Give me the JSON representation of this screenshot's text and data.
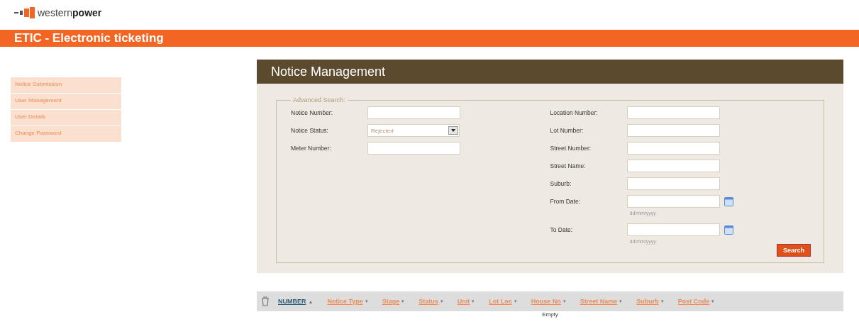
{
  "logo": {
    "text_light": "western",
    "text_bold": "power"
  },
  "banner": {
    "title": "ETIC - Electronic ticketing"
  },
  "sidebar": {
    "items": [
      {
        "label": "Notice Submission"
      },
      {
        "label": "User Management"
      },
      {
        "label": "User Details"
      },
      {
        "label": "Change Password"
      }
    ]
  },
  "panel": {
    "title": "Notice Management"
  },
  "search": {
    "legend": "Advanced Search:",
    "left_fields": [
      {
        "kind": "text",
        "label": "Notice Number:"
      },
      {
        "kind": "select",
        "label": "Notice Status:",
        "value": "Rejected"
      },
      {
        "kind": "text",
        "label": "Meter Number:"
      }
    ],
    "right_fields": [
      {
        "kind": "text",
        "label": "Location Number:"
      },
      {
        "kind": "text",
        "label": "Lot Number:"
      },
      {
        "kind": "text",
        "label": "Street Number:"
      },
      {
        "kind": "text",
        "label": "Street Name:"
      },
      {
        "kind": "text",
        "label": "Suburb:"
      },
      {
        "kind": "date",
        "label": "From Date:",
        "hint": "dd/mm/yyyy"
      },
      {
        "kind": "date",
        "label": "To Date:",
        "hint": "dd/mm/yyyy"
      }
    ],
    "button": "Search"
  },
  "table": {
    "columns": [
      {
        "label": "NUMBER",
        "arrow": "▲",
        "selected": true
      },
      {
        "label": "Notice Type",
        "arrow": "▾",
        "selected": false
      },
      {
        "label": "Stage",
        "arrow": "▾",
        "selected": false
      },
      {
        "label": "Status",
        "arrow": "▾",
        "selected": false
      },
      {
        "label": "Unit",
        "arrow": "▾",
        "selected": false
      },
      {
        "label": "Lot Loc",
        "arrow": "▾",
        "selected": false
      },
      {
        "label": "House No",
        "arrow": "▾",
        "selected": false
      },
      {
        "label": "Street Name",
        "arrow": "▾",
        "selected": false
      },
      {
        "label": "Suburb",
        "arrow": "▾",
        "selected": false
      },
      {
        "label": "Post Code",
        "arrow": "▾",
        "selected": false
      }
    ],
    "empty_text": "Empty"
  }
}
